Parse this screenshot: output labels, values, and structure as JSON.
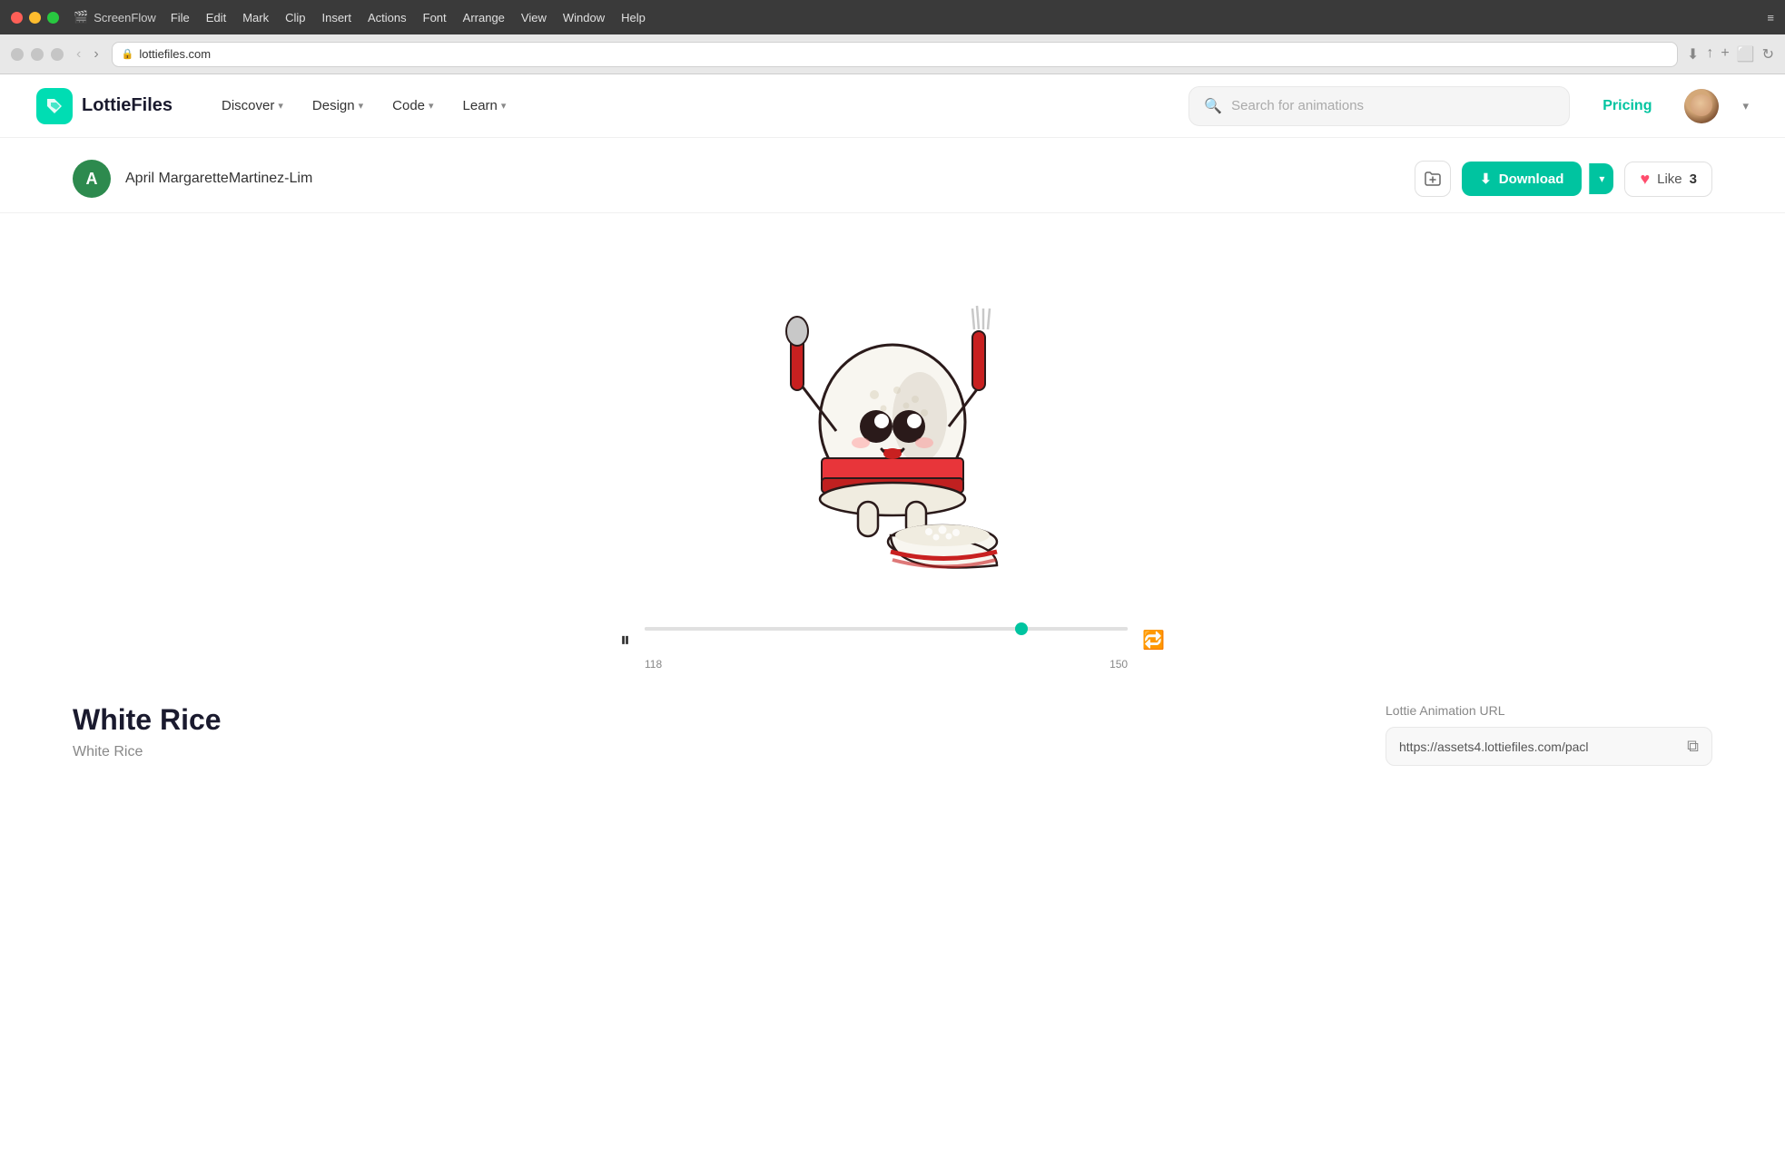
{
  "titlebar": {
    "app": "ScreenFlow",
    "menus": [
      "File",
      "Edit",
      "Mark",
      "Clip",
      "Insert",
      "Actions",
      "Font",
      "Arrange",
      "View",
      "Window",
      "Help"
    ]
  },
  "browser": {
    "url": "lottiefiles.com",
    "lock_icon": "🔒"
  },
  "navbar": {
    "logo_text": "LottieFiles",
    "nav_items": [
      {
        "label": "Discover",
        "has_dropdown": true
      },
      {
        "label": "Design",
        "has_dropdown": true
      },
      {
        "label": "Code",
        "has_dropdown": true
      },
      {
        "label": "Learn",
        "has_dropdown": true
      }
    ],
    "search_placeholder": "Search for animations",
    "pricing_label": "Pricing"
  },
  "animation_page": {
    "creator_initial": "A",
    "creator_name": "April MargaretteMartinez-Lim",
    "actions": {
      "add_to_folder_icon": "🗂",
      "download_label": "Download",
      "like_label": "Like",
      "like_count": "3"
    },
    "animation_title": "White Rice",
    "animation_subtitle": "White Rice",
    "lottie_url_label": "Lottie Animation URL",
    "lottie_url": "https://assets4.lottiefiles.com/pacl",
    "playback": {
      "frame_start": "118",
      "frame_end": "150",
      "progress_percent": 78
    }
  }
}
